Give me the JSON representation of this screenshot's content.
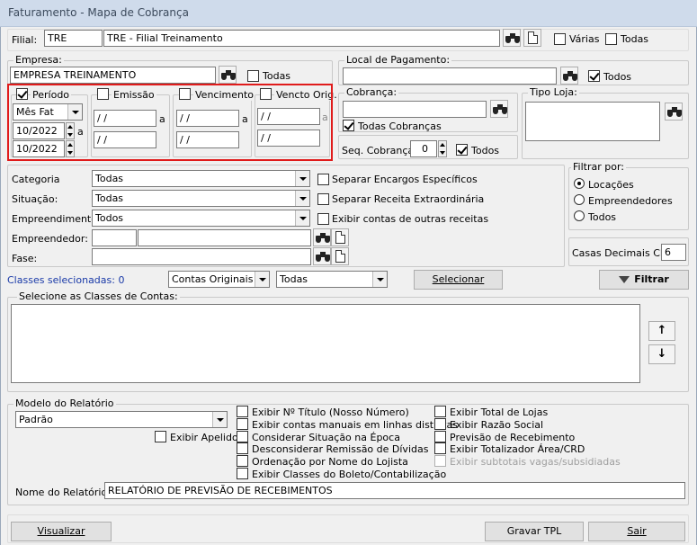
{
  "window": {
    "title": "Faturamento - Mapa de Cobrança"
  },
  "filial": {
    "label": "Filial:",
    "code": "TRE",
    "name": "TRE - Filial Treinamento",
    "varias": "Várias",
    "todas": "Todas"
  },
  "empresa": {
    "title": "Empresa:",
    "value": "EMPRESA TREINAMENTO",
    "todas": "Todas"
  },
  "local_pagamento": {
    "title": "Local de Pagamento:",
    "value": "",
    "todos": "Todos"
  },
  "periodo": {
    "title": "Período",
    "select": "Mês Fat",
    "from": "10/2022",
    "to": "10/2022",
    "a": "a"
  },
  "emissao": {
    "title": "Emissão",
    "from": "/ /",
    "to": "/ /",
    "a": "a"
  },
  "vencimento": {
    "title": "Vencimento",
    "from": "/ /",
    "to": "/ /",
    "a": "a"
  },
  "vencto_orig": {
    "title": "Vencto Orig.",
    "from": "/ /",
    "to": "/ /",
    "a": "a"
  },
  "cobranca": {
    "title": "Cobrança:",
    "value": "",
    "todas": "Todas Cobranças"
  },
  "seq_cobranca": {
    "label": "Seq. Cobrança:",
    "value": "0",
    "todos": "Todos"
  },
  "tipo_loja": {
    "title": "Tipo Loja:"
  },
  "filters": {
    "categoria": {
      "label": "Categoria",
      "value": "Todas"
    },
    "situacao": {
      "label": "Situação:",
      "value": "Todas"
    },
    "empreendimento": {
      "label": "Empreendimento:",
      "value": "Todos"
    },
    "empreendedor": {
      "label": "Empreendedor:"
    },
    "fase": {
      "label": "Fase:"
    }
  },
  "options": {
    "separar_encargos": "Separar Encargos Específicos",
    "separar_receita": "Separar Receita Extraordinária",
    "exibir_contas": "Exibir contas de outras receitas"
  },
  "filtrar_por": {
    "title": "Filtrar por:",
    "locacoes": "Locações",
    "empreendedores": "Empreendedores",
    "todos": "Todos"
  },
  "casas_decimais": {
    "label": "Casas Decimais CRD",
    "value": "6"
  },
  "classes": {
    "label": "Classes selecionadas: 0",
    "contas_select": "Contas Originais",
    "todas_select": "Todas",
    "selecionar": "Selecionar",
    "filtrar": "Filtrar",
    "list_title": "Selecione as Classes de Contas:"
  },
  "modelo": {
    "title": "Modelo do Relatório",
    "value": "Padrão",
    "exibir_apelido": "Exibir Apelido"
  },
  "checks_col1": [
    "Exibir Nº Título (Nosso Número)",
    "Exibir contas manuais em linhas distintas",
    "Considerar Situação na Época",
    "Desconsiderar Remissão de Dívidas",
    "Ordenação por Nome do Lojista",
    "Exibir Classes do Boleto/Contabilização"
  ],
  "checks_col2": [
    "Exibir Total de Lojas",
    "Exibir Razão Social",
    "Previsão de Recebimento",
    "Exibir Totalizador Área/CRD",
    "Exibir subtotais vagas/subsidiadas"
  ],
  "nome_relatorio": {
    "label": "Nome do Relatório:",
    "value": "RELATÓRIO DE PREVISÃO DE RECEBIMENTOS"
  },
  "buttons": {
    "visualizar": "Visualizar",
    "gravar": "Gravar TPL",
    "sair": "Sair"
  }
}
